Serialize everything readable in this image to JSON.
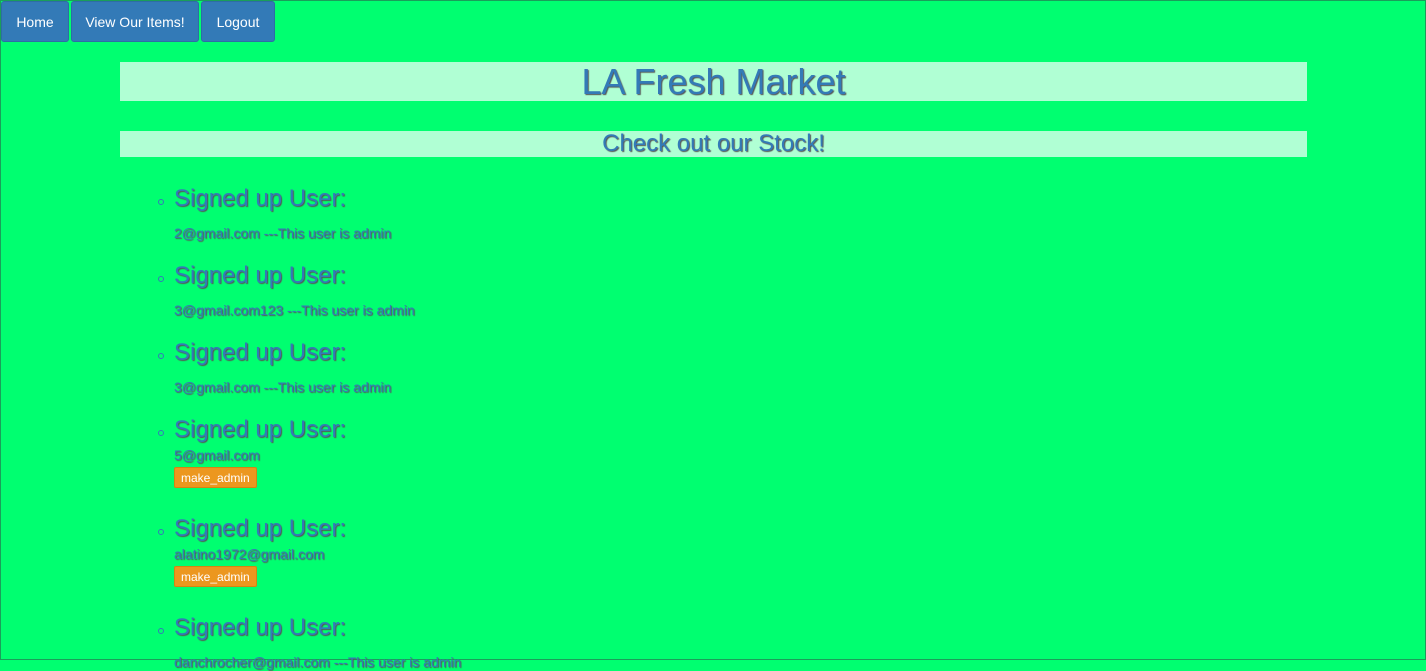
{
  "nav": {
    "home": "Home",
    "items": "View Our Items!",
    "logout": "Logout"
  },
  "title": "LA Fresh Market",
  "subtitle": "Check out our Stock!",
  "users": [
    {
      "heading": "Signed up User:",
      "email": "2@gmail.com ---This user is admin",
      "button": null
    },
    {
      "heading": "Signed up User:",
      "email": "3@gmail.com123 ---This user is admin",
      "button": null
    },
    {
      "heading": "Signed up User:",
      "email": "3@gmail.com ---This user is admin",
      "button": null
    },
    {
      "heading": "Signed up User:",
      "email": "5@gmail.com",
      "button": "make_admin"
    },
    {
      "heading": "Signed up User:",
      "email": "alatino1972@gmail.com",
      "button": "make_admin"
    },
    {
      "heading": "Signed up User:",
      "email": "danchrocher@gmail.com ---This user is admin",
      "button": null
    }
  ],
  "colors": {
    "background": "#00ff70",
    "accent": "#337ab7",
    "banner": "#b0ffd4",
    "warning_button": "#ec971f"
  }
}
